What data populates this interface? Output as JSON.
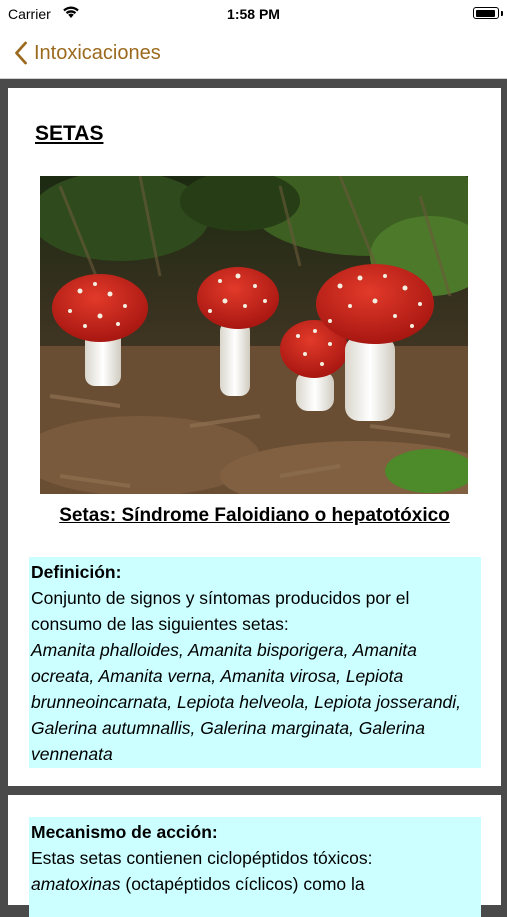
{
  "status": {
    "carrier": "Carrier",
    "time": "1:58 PM",
    "battery_level": 0.95
  },
  "nav": {
    "back_label": "Intoxicaciones"
  },
  "page": {
    "title": "SETAS",
    "subtitle": "Setas: Síndrome Faloidiano o hepatotóxico",
    "photo_icon": "mushroom-photo"
  },
  "definicion": {
    "heading": "Definición:",
    "text": "Conjunto de signos y síntomas producidos por el consumo de las siguientes setas:",
    "species": "Amanita phalloides, Amanita bisporigera, Amanita ocreata, Amanita verna, Amanita virosa, Lepiota brunneoincarnata, Lepiota helveola, Lepiota josserandi, Galerina autumnallis, Galerina marginata, Galerina vennenata"
  },
  "mecanismo": {
    "heading": "Mecanismo de acción:",
    "text": "Estas setas contienen ciclopéptidos tóxicos:",
    "italic_term": "amatoxinas",
    "text_after": " (octapéptidos cíclicos) como la"
  },
  "colors": {
    "accent": "#9b6a1f",
    "box_bg": "#ccffff",
    "background": "#4a4a4a"
  }
}
